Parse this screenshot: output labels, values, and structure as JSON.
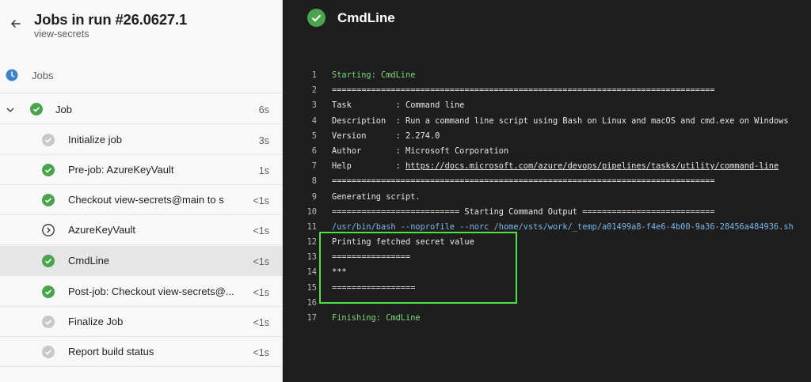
{
  "header": {
    "title": "Jobs in run #26.0627.1",
    "subtitle": "view-secrets"
  },
  "jobs_section_label": "Jobs",
  "job": {
    "name": "Job",
    "duration": "6s"
  },
  "steps": [
    {
      "name": "Initialize job",
      "duration": "3s",
      "status": "skipped"
    },
    {
      "name": "Pre-job: AzureKeyVault",
      "duration": "1s",
      "status": "success"
    },
    {
      "name": "Checkout view-secrets@main to s",
      "duration": "<1s",
      "status": "success"
    },
    {
      "name": "AzureKeyVault",
      "duration": "<1s",
      "status": "pending"
    },
    {
      "name": "CmdLine",
      "duration": "<1s",
      "status": "success"
    },
    {
      "name": "Post-job: Checkout view-secrets@...",
      "duration": "<1s",
      "status": "success"
    },
    {
      "name": "Finalize Job",
      "duration": "<1s",
      "status": "skipped"
    },
    {
      "name": "Report build status",
      "duration": "<1s",
      "status": "skipped"
    }
  ],
  "selected_step": "CmdLine",
  "log_panel": {
    "title": "CmdLine",
    "lines": [
      {
        "n": "1",
        "text": "Starting: CmdLine",
        "style": "green"
      },
      {
        "n": "2",
        "text": "==============================================================================",
        "style": "normal"
      },
      {
        "n": "3",
        "text": "Task         : Command line",
        "style": "normal"
      },
      {
        "n": "4",
        "text": "Description  : Run a command line script using Bash on Linux and macOS and cmd.exe on Windows",
        "style": "normal"
      },
      {
        "n": "5",
        "text": "Version      : 2.274.0",
        "style": "normal"
      },
      {
        "n": "6",
        "text": "Author       : Microsoft Corporation",
        "style": "normal"
      },
      {
        "n": "7",
        "text": "Help         : ",
        "link": "https://docs.microsoft.com/azure/devops/pipelines/tasks/utility/command-line",
        "style": "normal"
      },
      {
        "n": "8",
        "text": "==============================================================================",
        "style": "normal"
      },
      {
        "n": "9",
        "text": "Generating script.",
        "style": "normal"
      },
      {
        "n": "10",
        "text": "========================== Starting Command Output ===========================",
        "style": "normal"
      },
      {
        "n": "11",
        "text": "/usr/bin/bash --noprofile --norc /home/vsts/work/_temp/a01499a8-f4e6-4b00-9a36-28456a484936.sh",
        "style": "blue"
      },
      {
        "n": "12",
        "text": "Printing fetched secret value",
        "style": "normal"
      },
      {
        "n": "13",
        "text": "================",
        "style": "normal"
      },
      {
        "n": "14",
        "text": "***",
        "style": "normal"
      },
      {
        "n": "15",
        "text": "=================",
        "style": "normal"
      },
      {
        "n": "16",
        "text": "",
        "style": "normal"
      },
      {
        "n": "17",
        "text": "Finishing: CmdLine",
        "style": "green"
      }
    ]
  },
  "colors": {
    "success": "#4aa44e",
    "skipped": "#c8c8c8",
    "clock": "#3f83c4",
    "highlight": "#4ee341"
  }
}
